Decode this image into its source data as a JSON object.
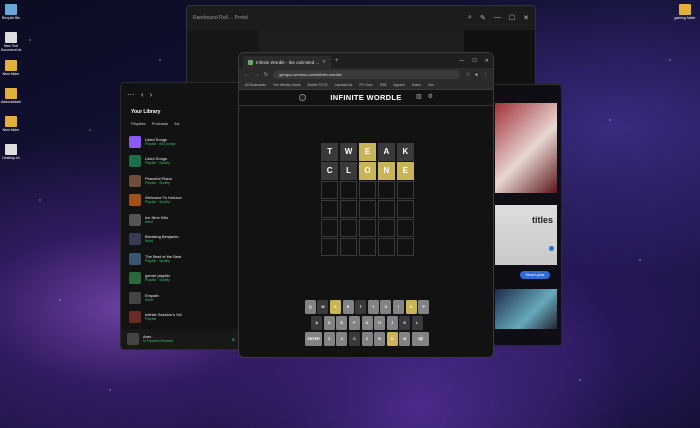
{
  "desktop": {
    "icons": [
      {
        "label": "Recycle Bin",
        "kind": "recycle"
      },
      {
        "label": "New Text Document.txt",
        "kind": "doc"
      },
      {
        "label": "New folder",
        "kind": "folder"
      },
      {
        "label": "doblockfolder",
        "kind": "folder"
      },
      {
        "label": "New folder",
        "kind": "folder"
      },
      {
        "label": "Desktop.ini",
        "kind": "doc"
      }
    ],
    "right_icons": [
      {
        "label": "gaming folder",
        "kind": "folder"
      }
    ]
  },
  "bg_window": {
    "title": "Rarebound Roll ... Portal"
  },
  "spotify": {
    "library_title": "Your Library",
    "chips": [
      "Playlists",
      "Podcasts",
      "Art"
    ],
    "items": [
      {
        "name": "Liked Songs",
        "sub": "Playlist · 843 songs",
        "color": "#8a5cf6"
      },
      {
        "name": "Liked Songs",
        "sub": "Playlist · Spotify",
        "color": "#1f6e4a"
      },
      {
        "name": "Peaceful Piano",
        "sub": "Playlist · Spotify",
        "color": "#6b4f3a"
      },
      {
        "name": "Welcome To Horizon",
        "sub": "Playlist · Spotify",
        "color": "#a0521a"
      },
      {
        "name": "Ice Nine Kills",
        "sub": "Artist",
        "color": "#555"
      },
      {
        "name": "Breaking Benjamin",
        "sub": "Artist",
        "color": "#3a3a55"
      },
      {
        "name": "The Best of the Best",
        "sub": "Playlist · Spotify",
        "color": "#3a5570"
      },
      {
        "name": "gamer playlist",
        "sub": "Playlist · Spotify",
        "color": "#2a6a3a"
      },
      {
        "name": "Empath",
        "sub": "Artist",
        "color": "#444"
      },
      {
        "name": "Infinite Session's Vol",
        "sub": "Playlist",
        "color": "#6a2a2a"
      }
    ],
    "now_playing": {
      "title": "Ares",
      "artist": "In Flames Remixed"
    }
  },
  "right_window": {
    "caption": "titles",
    "button": "Show Lyrics"
  },
  "chrome": {
    "tab_title": "Infinite Wordle - the unlimited ...",
    "url": "geegoo.wembs.com/infinite-wordle/",
    "bookmarks": [
      "All Bookmarks",
      "Yo's Weekly Game",
      "Mobile GOTS",
      "Layouts/Cat",
      "PIX Gam",
      "DSB",
      "Apparel",
      "Anime",
      "Dev"
    ]
  },
  "game": {
    "title": "INFINITE WORDLE",
    "rows": [
      [
        {
          "l": "T",
          "s": "gray"
        },
        {
          "l": "W",
          "s": "gray"
        },
        {
          "l": "E",
          "s": "yellow"
        },
        {
          "l": "A",
          "s": "gray"
        },
        {
          "l": "K",
          "s": "gray"
        }
      ],
      [
        {
          "l": "C",
          "s": "gray"
        },
        {
          "l": "L",
          "s": "gray"
        },
        {
          "l": "O",
          "s": "yellow"
        },
        {
          "l": "N",
          "s": "yellow"
        },
        {
          "l": "E",
          "s": "yellow"
        }
      ],
      [],
      [],
      [],
      []
    ],
    "keyboard": [
      [
        {
          "k": "Q",
          "s": "n"
        },
        {
          "k": "W",
          "s": "d"
        },
        {
          "k": "E",
          "s": "y"
        },
        {
          "k": "R",
          "s": "n"
        },
        {
          "k": "T",
          "s": "d"
        },
        {
          "k": "Y",
          "s": "n"
        },
        {
          "k": "U",
          "s": "n"
        },
        {
          "k": "I",
          "s": "n"
        },
        {
          "k": "O",
          "s": "y"
        },
        {
          "k": "P",
          "s": "n"
        }
      ],
      [
        {
          "k": "A",
          "s": "d"
        },
        {
          "k": "S",
          "s": "n"
        },
        {
          "k": "D",
          "s": "n"
        },
        {
          "k": "F",
          "s": "n"
        },
        {
          "k": "G",
          "s": "n"
        },
        {
          "k": "H",
          "s": "n"
        },
        {
          "k": "J",
          "s": "n"
        },
        {
          "k": "K",
          "s": "d"
        },
        {
          "k": "L",
          "s": "d"
        }
      ],
      [
        {
          "k": "ENTER",
          "s": "n",
          "w": 1
        },
        {
          "k": "Z",
          "s": "n"
        },
        {
          "k": "X",
          "s": "n"
        },
        {
          "k": "C",
          "s": "d"
        },
        {
          "k": "V",
          "s": "n"
        },
        {
          "k": "B",
          "s": "n"
        },
        {
          "k": "N",
          "s": "y"
        },
        {
          "k": "M",
          "s": "n"
        },
        {
          "k": "⌫",
          "s": "n",
          "w": 1
        }
      ]
    ]
  }
}
